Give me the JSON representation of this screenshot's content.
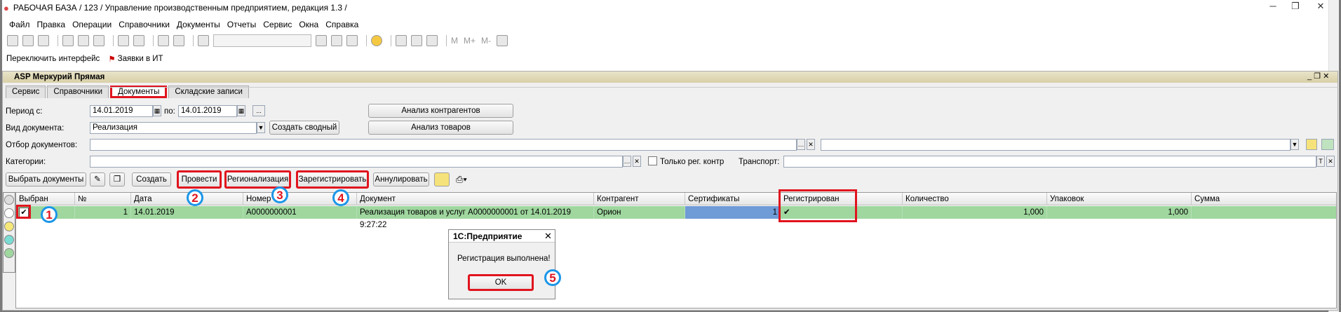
{
  "window": {
    "title": "РАБОЧАЯ БАЗА / 123 /  Управление производственным предприятием, редакция 1.3 /"
  },
  "menu": [
    "Файл",
    "Правка",
    "Операции",
    "Справочники",
    "Документы",
    "Отчеты",
    "Сервис",
    "Окна",
    "Справка"
  ],
  "toolbar2": {
    "switch_interface": "Переключить интерфейс",
    "requests": "Заявки в ИТ"
  },
  "subwindow": {
    "title": "ASP Меркурий Прямая"
  },
  "tabs": [
    "Сервис",
    "Справочники",
    "Документы",
    "Складские записи"
  ],
  "filters": {
    "period_from_label": "Период с:",
    "period_from": "14.01.2019",
    "period_to_label": "по:",
    "period_to": "14.01.2019",
    "doc_type_label": "Вид документа:",
    "doc_type": "Реализация",
    "create_summary": "Создать сводный",
    "selection_label": "Отбор документов:",
    "categories_label": "Категории:",
    "only_reg_label": "Только рег. контр",
    "transport_label": "Транспорт:",
    "analysis_contractors": "Анализ контрагентов",
    "analysis_goods": "Анализ товаров"
  },
  "actions": {
    "select_docs": "Выбрать документы",
    "create": "Создать",
    "post": "Провести",
    "regionalize": "Регионализация",
    "register": "Зарегистрировать",
    "cancel": "Аннулировать"
  },
  "table": {
    "headers": [
      "Выбран",
      "№",
      "Дата",
      "Номер",
      "Документ",
      "Контрагент",
      "Сертификаты",
      "Регистрирован",
      "Количество",
      "Упаковок",
      "Сумма"
    ],
    "row": {
      "num": "1",
      "date": "14.01.2019",
      "number": "А0000000001",
      "document": "Реализация товаров и услуг А0000000001 от 14.01.2019 9:27:22",
      "contractor": "Орион",
      "certificates": "1",
      "registered": "✔",
      "quantity": "1,000",
      "packages": "1,000",
      "sum": ""
    }
  },
  "dialog": {
    "title": "1С:Предприятие",
    "message": "Регистрация выполнена!",
    "ok": "OK"
  },
  "markers": [
    "1",
    "2",
    "3",
    "4",
    "5"
  ],
  "colors": {
    "highlight": "#e0141e",
    "marker_ring": "#1c96e8",
    "row": "#9fd79f"
  }
}
